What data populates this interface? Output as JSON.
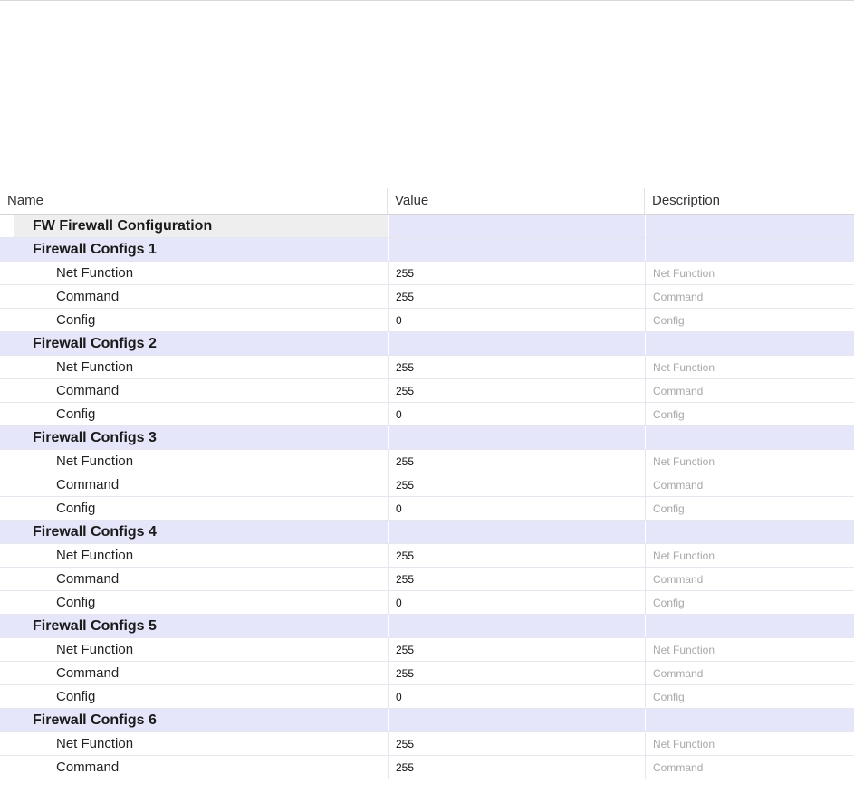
{
  "columns": {
    "name": "Name",
    "value": "Value",
    "description": "Description"
  },
  "root": {
    "name": "FW Firewall Configuration"
  },
  "groups": [
    {
      "name": "Firewall Configs 1",
      "items": [
        {
          "name": "Net Function",
          "value": "255",
          "description": "Net Function"
        },
        {
          "name": "Command",
          "value": "255",
          "description": "Command"
        },
        {
          "name": "Config",
          "value": "0",
          "description": "Config"
        }
      ]
    },
    {
      "name": "Firewall Configs 2",
      "items": [
        {
          "name": "Net Function",
          "value": "255",
          "description": "Net Function"
        },
        {
          "name": "Command",
          "value": "255",
          "description": "Command"
        },
        {
          "name": "Config",
          "value": "0",
          "description": "Config"
        }
      ]
    },
    {
      "name": "Firewall Configs 3",
      "items": [
        {
          "name": "Net Function",
          "value": "255",
          "description": "Net Function"
        },
        {
          "name": "Command",
          "value": "255",
          "description": "Command"
        },
        {
          "name": "Config",
          "value": "0",
          "description": "Config"
        }
      ]
    },
    {
      "name": "Firewall Configs 4",
      "items": [
        {
          "name": "Net Function",
          "value": "255",
          "description": "Net Function"
        },
        {
          "name": "Command",
          "value": "255",
          "description": "Command"
        },
        {
          "name": "Config",
          "value": "0",
          "description": "Config"
        }
      ]
    },
    {
      "name": "Firewall Configs 5",
      "items": [
        {
          "name": "Net Function",
          "value": "255",
          "description": "Net Function"
        },
        {
          "name": "Command",
          "value": "255",
          "description": "Command"
        },
        {
          "name": "Config",
          "value": "0",
          "description": "Config"
        }
      ]
    },
    {
      "name": "Firewall Configs 6",
      "items": [
        {
          "name": "Net Function",
          "value": "255",
          "description": "Net Function"
        },
        {
          "name": "Command",
          "value": "255",
          "description": "Command"
        }
      ]
    }
  ]
}
